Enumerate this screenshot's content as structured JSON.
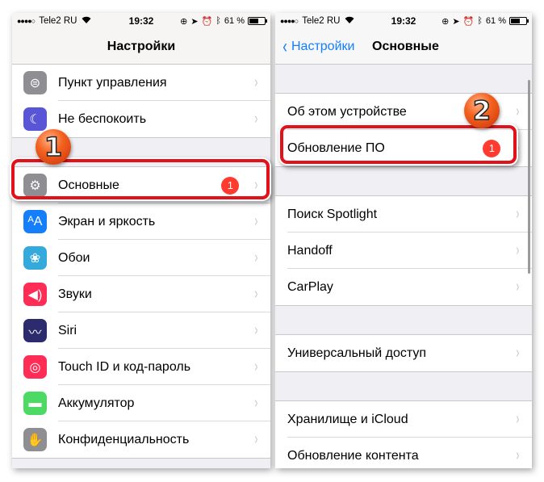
{
  "status_bar": {
    "signal": "●●●●○",
    "carrier": "Tele2 RU",
    "time": "19:32",
    "icons": [
      "rotation-lock-icon",
      "location-icon",
      "alarm-icon",
      "bluetooth-icon"
    ],
    "battery_text": "61 %",
    "battery_level": 0.61
  },
  "left": {
    "title": "Настройки",
    "group1": [
      {
        "label": "Пункт управления",
        "icon": "control-center-icon",
        "color": "#8e8e93",
        "glyph": "⊜"
      },
      {
        "label": "Не беспокоить",
        "icon": "moon-icon",
        "color": "#5856d6",
        "glyph": "☾"
      }
    ],
    "group2": [
      {
        "label": "Основные",
        "icon": "gear-icon",
        "color": "#8e8e93",
        "glyph": "⚙",
        "badge": "1"
      },
      {
        "label": "Экран и яркость",
        "icon": "display-icon",
        "color": "#147efb",
        "glyph": "ᴬA"
      },
      {
        "label": "Обои",
        "icon": "wallpaper-flower-icon",
        "color": "#34aadc",
        "glyph": "❀"
      },
      {
        "label": "Звуки",
        "icon": "speaker-icon",
        "color": "#ff2d55",
        "glyph": "◀)"
      },
      {
        "label": "Siri",
        "icon": "siri-icon",
        "color": "#2b2b6e",
        "glyph": "〰"
      },
      {
        "label": "Touch ID и код-пароль",
        "icon": "fingerprint-icon",
        "color": "#ff2d55",
        "glyph": "◎"
      },
      {
        "label": "Аккумулятор",
        "icon": "battery-icon",
        "color": "#4cd964",
        "glyph": "▬"
      },
      {
        "label": "Конфиденциальность",
        "icon": "hand-icon",
        "color": "#8e8e93",
        "glyph": "✋"
      }
    ],
    "step_label": "1"
  },
  "right": {
    "back_label": "Настройки",
    "title": "Основные",
    "group1": [
      {
        "label": "Об этом устройстве"
      },
      {
        "label": "Обновление ПО",
        "badge": "1"
      }
    ],
    "group2": [
      {
        "label": "Поиск Spotlight"
      },
      {
        "label": "Handoff"
      },
      {
        "label": "CarPlay"
      }
    ],
    "group3": [
      {
        "label": "Универсальный доступ"
      }
    ],
    "group4": [
      {
        "label": "Хранилище и iCloud"
      },
      {
        "label": "Обновление контента"
      }
    ],
    "step_label": "2"
  },
  "chevron": "›",
  "back_chevron": "‹"
}
